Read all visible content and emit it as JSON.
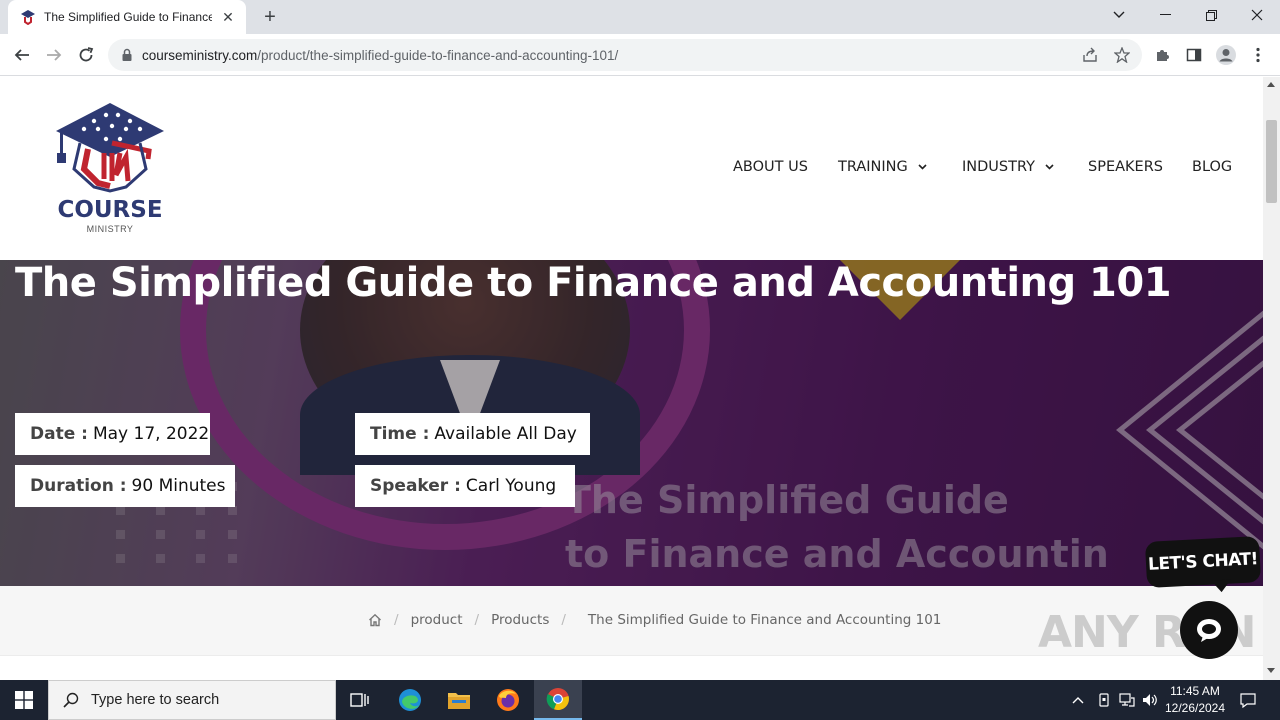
{
  "browser": {
    "tab_title": "The Simplified Guide to Finance",
    "url_host": "courseministry.com",
    "url_path": "/product/the-simplified-guide-to-finance-and-accounting-101/"
  },
  "site": {
    "logo_text": "COURSE",
    "logo_subtext": "MINISTRY",
    "nav": [
      {
        "label": "ABOUT US"
      },
      {
        "label": "TRAINING"
      },
      {
        "label": "INDUSTRY"
      },
      {
        "label": "SPEAKERS"
      },
      {
        "label": "BLOG"
      }
    ]
  },
  "hero": {
    "title": "The Simplified Guide to Finance and Accounting 101",
    "date_label": "Date :",
    "date_value": "May 17, 2022",
    "time_label": "Time :",
    "time_value": "Available All Day",
    "duration_label": "Duration :",
    "duration_value": "90 Minutes",
    "speaker_label": "Speaker :",
    "speaker_value": "Carl Young",
    "banner_line1": "The Simplified Guide",
    "banner_line2": "to Finance and Accountin"
  },
  "breadcrumb": {
    "items": [
      "product",
      "Products"
    ],
    "current": "The Simplified Guide to Finance and Accounting 101"
  },
  "chat": {
    "bubble_text": "LET'S CHAT!"
  },
  "watermark": "ANY RUN",
  "taskbar": {
    "search_placeholder": "Type here to search",
    "time": "11:45 AM",
    "date": "12/26/2024"
  },
  "colors": {
    "brand_navy": "#2e3a73",
    "brand_red": "#c0242f",
    "hero_purple": "#5d1f6b",
    "taskbar": "#1c2331"
  }
}
